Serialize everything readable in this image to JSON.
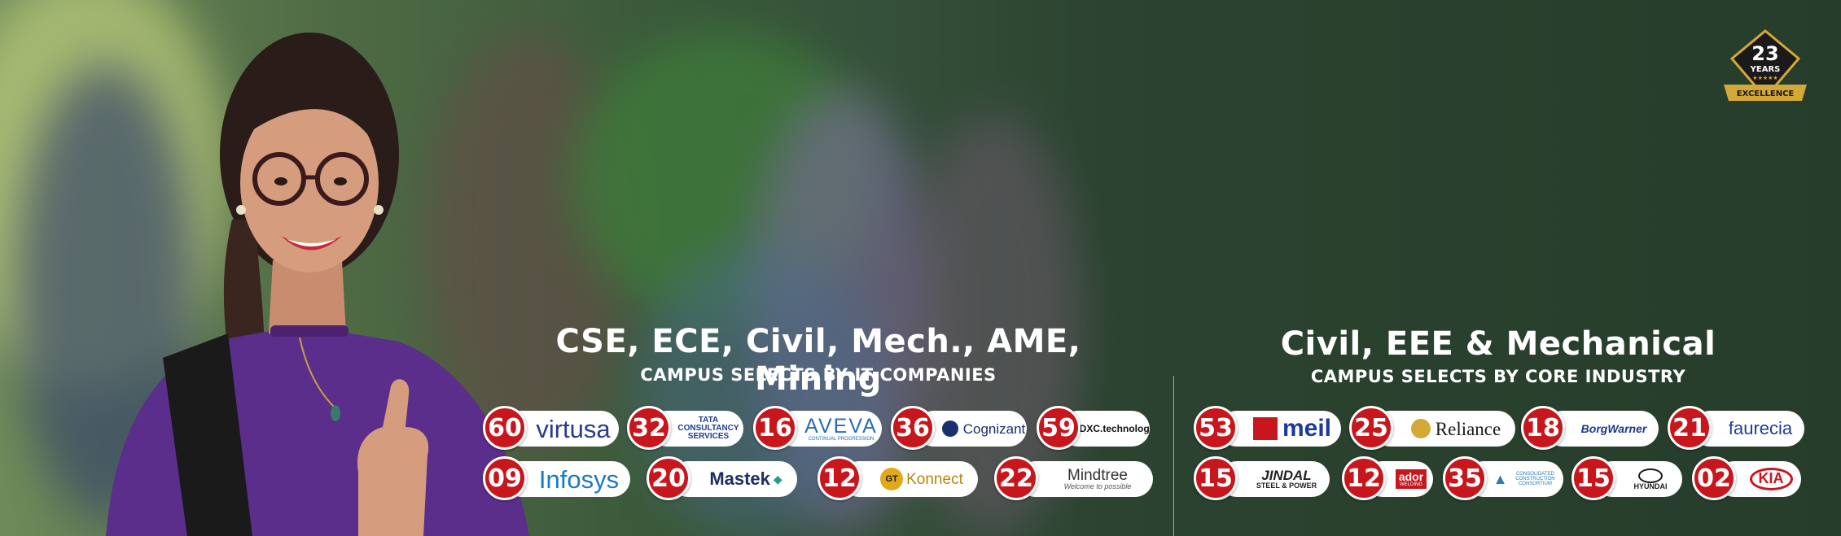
{
  "badge": {
    "number": "23",
    "line1": "YEARS",
    "line2": "EXCELLENCE"
  },
  "it_section": {
    "title": "CSE, ECE, Civil, Mech., AME, Mining",
    "subtitle": "CAMPUS SELECTS BY IT COMPANIES",
    "companies": [
      {
        "count": "60",
        "logo": "virtusa",
        "color": "#2a3a8c"
      },
      {
        "count": "32",
        "logo": "TATA CONSULTANCY SERVICES",
        "color": "#1f3c8f"
      },
      {
        "count": "16",
        "logo": "AVEVA",
        "tagline": "CONTINUAL PROGRESSION",
        "color": "#2b6db5"
      },
      {
        "count": "36",
        "logo": "Cognizant",
        "color": "#1a2f6d"
      },
      {
        "count": "59",
        "logo": "DXC.technology",
        "color": "#111111"
      },
      {
        "count": "09",
        "logo": "Infosys",
        "color": "#1e78c8"
      },
      {
        "count": "20",
        "logo": "Mastek",
        "color": "#1c2e63"
      },
      {
        "count": "12",
        "logo": "Konnect",
        "prefix": "GT",
        "color": "#b8860b"
      },
      {
        "count": "22",
        "logo": "Mindtree",
        "tagline": "Welcome to possible",
        "color": "#333333"
      }
    ]
  },
  "core_section": {
    "title": "Civil, EEE & Mechanical",
    "subtitle": "CAMPUS SELECTS BY CORE INDUSTRY",
    "companies": [
      {
        "count": "53",
        "logo": "meil",
        "color": "#1a3a9c"
      },
      {
        "count": "25",
        "logo": "Reliance",
        "color": "#1a1a1a"
      },
      {
        "count": "18",
        "logo": "BorgWarner",
        "color": "#1a3a8c"
      },
      {
        "count": "21",
        "logo": "faurecia",
        "color": "#1c3f8f"
      },
      {
        "count": "15",
        "logo": "JINDAL",
        "tagline": "STEEL & POWER",
        "color": "#222222"
      },
      {
        "count": "12",
        "logo": "ador",
        "tagline": "WELDING",
        "color": "#c8161d"
      },
      {
        "count": "35",
        "logo": "CONSOLIDATED CONSTRUCTION CONSORTIUM",
        "color": "#2b7bb9"
      },
      {
        "count": "15",
        "logo": "HYUNDAI",
        "color": "#1a1a1a"
      },
      {
        "count": "02",
        "logo": "KIA",
        "color": "#c8161d"
      }
    ]
  }
}
